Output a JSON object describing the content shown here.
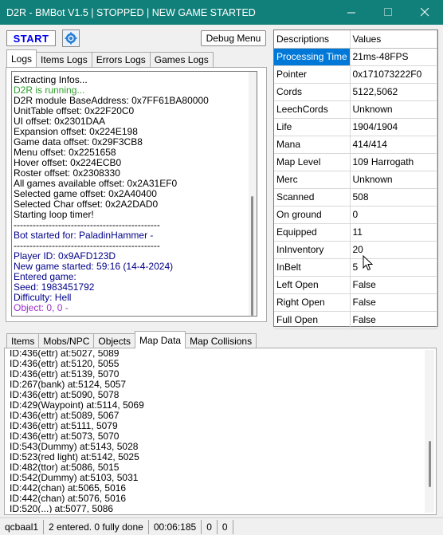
{
  "window": {
    "title": "D2R - BMBot V1.5 | STOPPED | NEW GAME STARTED",
    "minimize_icon": "minimize-icon",
    "maximize_icon": "maximize-icon",
    "close_icon": "close-icon"
  },
  "controls": {
    "start_label": "START",
    "settings_icon": "gear-icon",
    "debug_label": "Debug Menu"
  },
  "log_tabs": [
    "Logs",
    "Items Logs",
    "Errors Logs",
    "Games Logs"
  ],
  "log_lines": [
    {
      "text": "Extracting Infos...",
      "color": "#000000"
    },
    {
      "text": "D2R is running...",
      "color": "#2e9e2e"
    },
    {
      "text": "D2R module BaseAddress: 0x7FF61BA80000",
      "color": "#000000"
    },
    {
      "text": "UnitTable offset: 0x22F20C0",
      "color": "#000000"
    },
    {
      "text": "UI offset: 0x2301DAA",
      "color": "#000000"
    },
    {
      "text": "Expansion offset: 0x224E198",
      "color": "#000000"
    },
    {
      "text": "Game data offset: 0x29F3CB8",
      "color": "#000000"
    },
    {
      "text": "Menu offset: 0x2251658",
      "color": "#000000"
    },
    {
      "text": "Hover offset: 0x224ECB0",
      "color": "#000000"
    },
    {
      "text": "Roster offset: 0x2308330",
      "color": "#000000"
    },
    {
      "text": "All games available offset: 0x2A31EF0",
      "color": "#000000"
    },
    {
      "text": "Selected game offset: 0x2A40400",
      "color": "#000000"
    },
    {
      "text": "Selected Char offset: 0x2A2DAD0",
      "color": "#000000"
    },
    {
      "text": "Starting loop timer!",
      "color": "#000000"
    },
    {
      "text": "----------------------------------------------",
      "color": "#000000"
    },
    {
      "text": "Bot started for: PaladinHammer - ",
      "color": "#00008b"
    },
    {
      "text": "----------------------------------------------",
      "color": "#000000"
    },
    {
      "text": "Player ID: 0x9AFD123D",
      "color": "#00008b"
    },
    {
      "text": "New game started: 59:16 (14-4-2024)",
      "color": "#00008b"
    },
    {
      "text": "Entered game: ",
      "color": "#00008b"
    },
    {
      "text": "Seed: 1983451792",
      "color": "#00008b"
    },
    {
      "text": "Difficulty: Hell",
      "color": "#00008b"
    },
    {
      "text": "Object: 0, 0 -",
      "color": "#9b30c8"
    }
  ],
  "props": {
    "headers": [
      "Descriptions",
      "Values"
    ],
    "rows": [
      {
        "key": "Processing Time",
        "value": "21ms-48FPS"
      },
      {
        "key": "Pointer",
        "value": "0x171073222F0"
      },
      {
        "key": "Cords",
        "value": "5122,5062"
      },
      {
        "key": "LeechCords",
        "value": "Unknown"
      },
      {
        "key": "Life",
        "value": "1904/1904"
      },
      {
        "key": "Mana",
        "value": "414/414"
      },
      {
        "key": "Map Level",
        "value": "109 Harrogath"
      },
      {
        "key": "Merc",
        "value": "Unknown"
      },
      {
        "key": "Scanned",
        "value": "508"
      },
      {
        "key": "On ground",
        "value": "0"
      },
      {
        "key": "Equipped",
        "value": "11"
      },
      {
        "key": "InInventory",
        "value": "20"
      },
      {
        "key": "InBelt",
        "value": "5"
      },
      {
        "key": "Left Open",
        "value": "False"
      },
      {
        "key": "Right Open",
        "value": "False"
      },
      {
        "key": "Full Open",
        "value": "False"
      }
    ]
  },
  "map_tabs": [
    "Items",
    "Mobs/NPC",
    "Objects",
    "Map Data",
    "Map Collisions"
  ],
  "map_lines": [
    "ID:436(ettr) at:5027, 5089",
    "ID:436(ettr) at:5120, 5055",
    "ID:436(ettr) at:5139, 5070",
    "ID:267(bank) at:5124, 5057",
    "ID:436(ettr) at:5090, 5078",
    "ID:429(Waypoint) at:5114, 5069",
    "ID:436(ettr) at:5089, 5067",
    "ID:436(ettr) at:5111, 5079",
    "ID:436(ettr) at:5073, 5070",
    "ID:543(Dummy) at:5143, 5028",
    "ID:523(red light) at:5142, 5025",
    "ID:482(ttor) at:5086, 5015",
    "ID:542(Dummy) at:5103, 5031",
    "ID:442(chan) at:5065, 5016",
    "ID:442(chan) at:5076, 5016",
    "ID:520(...) at:5077, 5086"
  ],
  "status": {
    "account": "qcbaal1",
    "games": "2 entered. 0 fully done",
    "time": "00:06:185",
    "c1": "0",
    "c2": "0"
  }
}
